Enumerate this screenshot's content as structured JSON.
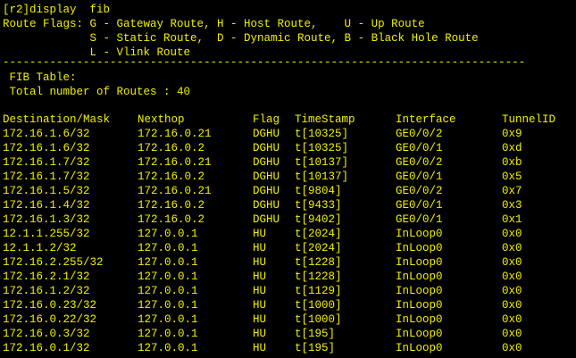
{
  "terminal": {
    "prompt_command": "[r2]display  fib",
    "flags_line1": "Route Flags: G - Gateway Route, H - Host Route,    U - Up Route",
    "flags_line2": "             S - Static Route,  D - Dynamic Route, B - Black Hole Route",
    "flags_line3": "             L - Vlink Route",
    "separator": "------------------------------------------------------------------------------",
    "fib_table_label": " FIB Table:",
    "total_routes": " Total number of Routes : 40",
    "columns": [
      "Destination/Mask",
      "Nexthop",
      "Flag",
      "TimeStamp",
      "Interface",
      "TunnelID"
    ],
    "rows": [
      [
        "172.16.1.6/32",
        "172.16.0.21",
        "DGHU",
        "t[10325]",
        "GE0/0/2",
        "0x9"
      ],
      [
        "172.16.1.6/32",
        "172.16.0.2",
        "DGHU",
        "t[10325]",
        "GE0/0/1",
        "0xd"
      ],
      [
        "172.16.1.7/32",
        "172.16.0.21",
        "DGHU",
        "t[10137]",
        "GE0/0/2",
        "0xb"
      ],
      [
        "172.16.1.7/32",
        "172.16.0.2",
        "DGHU",
        "t[10137]",
        "GE0/0/1",
        "0x5"
      ],
      [
        "172.16.1.5/32",
        "172.16.0.21",
        "DGHU",
        "t[9804]",
        "GE0/0/2",
        "0x7"
      ],
      [
        "172.16.1.4/32",
        "172.16.0.2",
        "DGHU",
        "t[9433]",
        "GE0/0/1",
        "0x3"
      ],
      [
        "172.16.1.3/32",
        "172.16.0.2",
        "DGHU",
        "t[9402]",
        "GE0/0/1",
        "0x1"
      ],
      [
        "12.1.1.255/32",
        "127.0.0.1",
        "HU",
        "t[2024]",
        "InLoop0",
        "0x0"
      ],
      [
        "12.1.1.2/32",
        "127.0.0.1",
        "HU",
        "t[2024]",
        "InLoop0",
        "0x0"
      ],
      [
        "172.16.2.255/32",
        "127.0.0.1",
        "HU",
        "t[1228]",
        "InLoop0",
        "0x0"
      ],
      [
        "172.16.2.1/32",
        "127.0.0.1",
        "HU",
        "t[1228]",
        "InLoop0",
        "0x0"
      ],
      [
        "172.16.1.2/32",
        "127.0.0.1",
        "HU",
        "t[1129]",
        "InLoop0",
        "0x0"
      ],
      [
        "172.16.0.23/32",
        "127.0.0.1",
        "HU",
        "t[1000]",
        "InLoop0",
        "0x0"
      ],
      [
        "172.16.0.22/32",
        "127.0.0.1",
        "HU",
        "t[1000]",
        "InLoop0",
        "0x0"
      ],
      [
        "172.16.0.3/32",
        "127.0.0.1",
        "HU",
        "t[195]",
        "InLoop0",
        "0x0"
      ],
      [
        "172.16.0.1/32",
        "127.0.0.1",
        "HU",
        "t[195]",
        "InLoop0",
        "0x0"
      ]
    ],
    "colors": {
      "background": "#000000",
      "text": "#f0f000"
    }
  }
}
